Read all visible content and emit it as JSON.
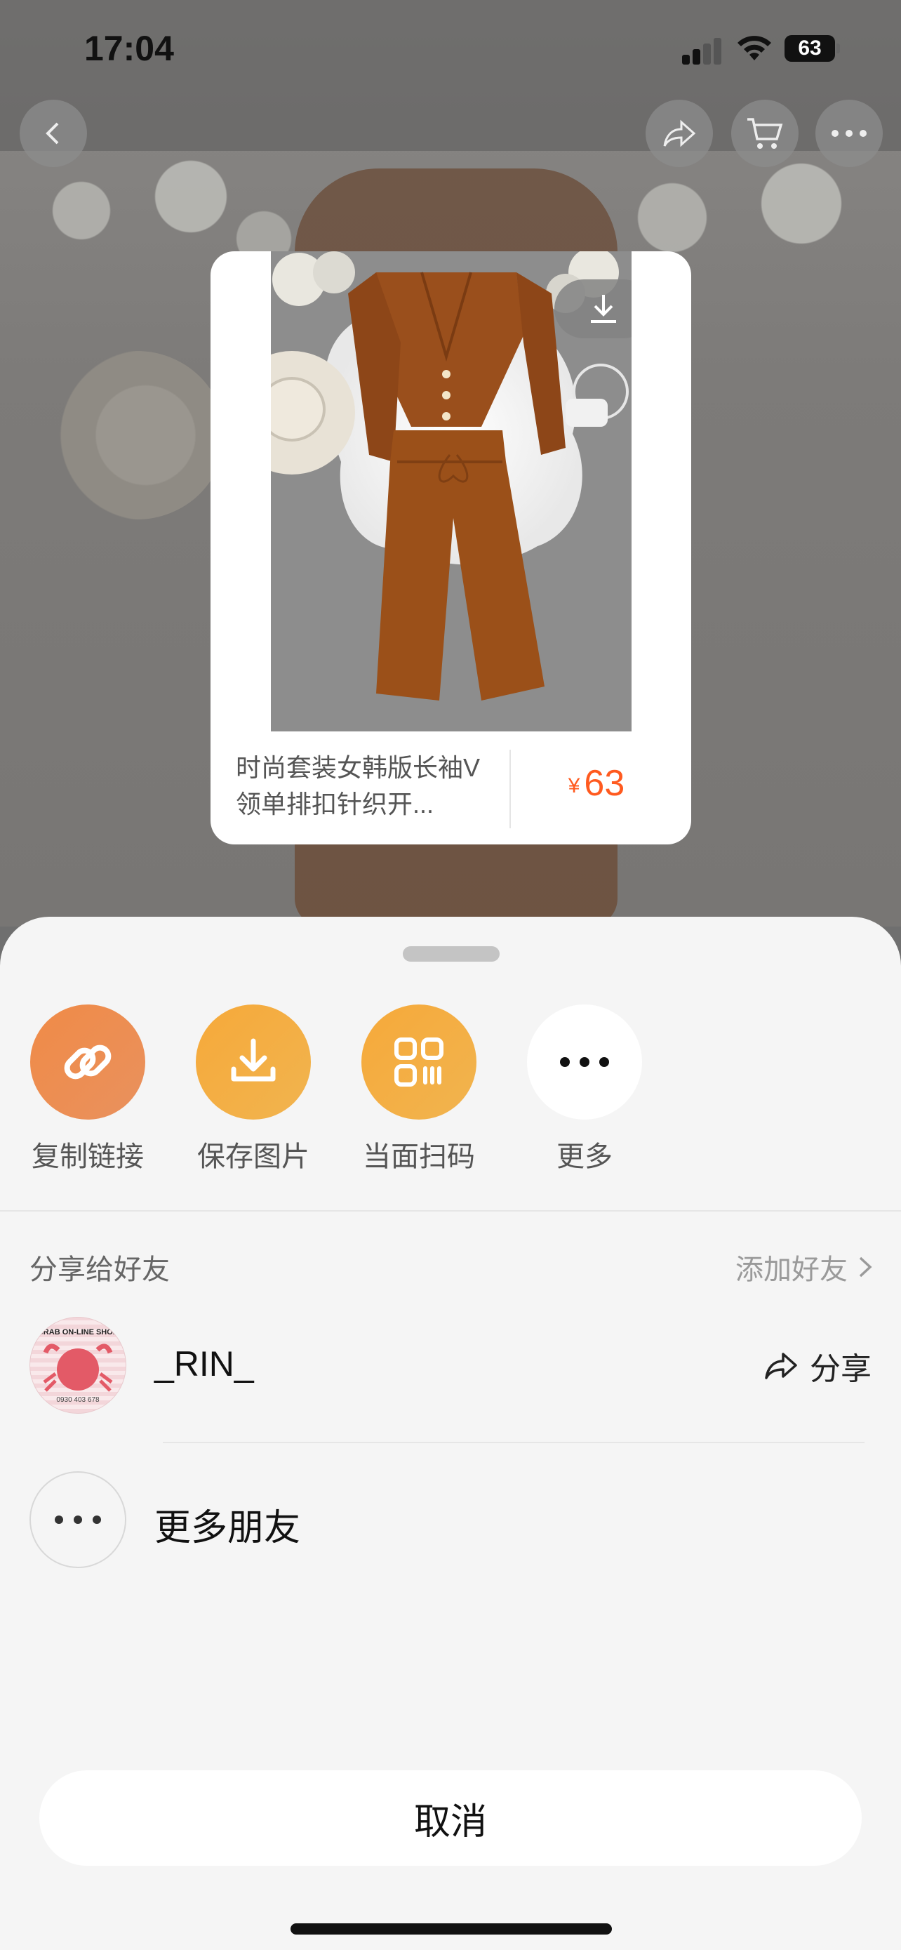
{
  "status_bar": {
    "time": "17:04",
    "battery": "63"
  },
  "product_card": {
    "title": "时尚套装女韩版长袖V领单排扣针织开...",
    "currency": "¥",
    "price": "63"
  },
  "share_actions": [
    {
      "label": "复制链接",
      "icon": "link-icon",
      "color": "#ec8a4d"
    },
    {
      "label": "保存图片",
      "icon": "download-icon",
      "color": "#f4a93c"
    },
    {
      "label": "当面扫码",
      "icon": "qr-code-icon",
      "color": "#f4a93c"
    },
    {
      "label": "更多",
      "icon": "more-icon",
      "color": "#ffffff"
    }
  ],
  "friends_section": {
    "title": "分享给好友",
    "add_friend": "添加好友",
    "contacts": [
      {
        "name": "_RIN_",
        "action": "分享"
      }
    ],
    "more_friends": "更多朋友"
  },
  "cancel_label": "取消"
}
